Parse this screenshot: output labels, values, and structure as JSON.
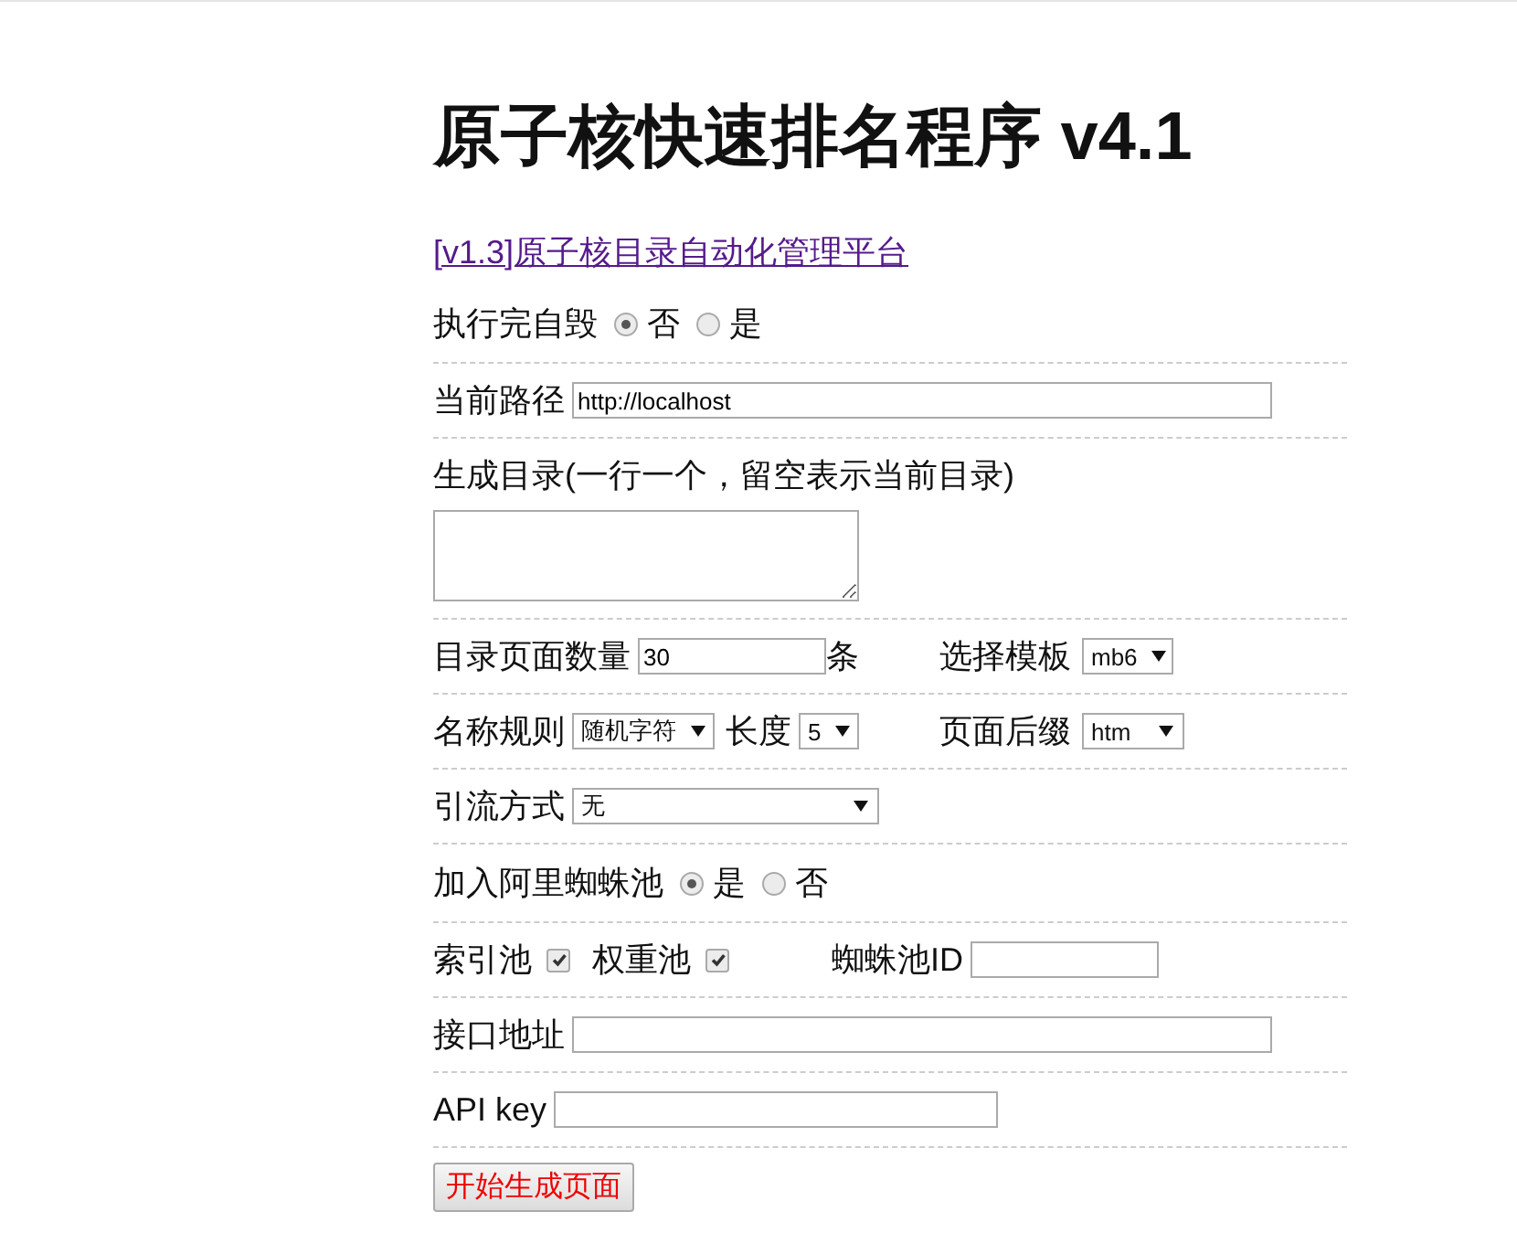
{
  "title": "原子核快速排名程序 v4.1",
  "link": "[v1.3]原子核目录自动化管理平台",
  "rows": [
    {
      "items": [
        {
          "kind": "text",
          "text": "执行完自毁"
        },
        {
          "kind": "radio",
          "label": "否",
          "selected": true
        },
        {
          "kind": "radio",
          "label": "是",
          "selected": false
        }
      ]
    },
    {
      "items": [
        {
          "kind": "text",
          "text": "当前路径"
        },
        {
          "kind": "input",
          "value": "http://localhost"
        }
      ]
    },
    {
      "items": [
        {
          "kind": "text",
          "text": "生成目录(一行一个，留空表示当前目录)"
        },
        {
          "kind": "textarea"
        }
      ]
    },
    {
      "items": [
        {
          "kind": "text",
          "text": "目录页面数量"
        },
        {
          "kind": "input",
          "value": "30"
        },
        {
          "kind": "text",
          "text": "条"
        },
        {
          "kind": "text",
          "text": "选择模板"
        },
        {
          "kind": "select",
          "value": "mb6"
        }
      ]
    },
    {
      "items": [
        {
          "kind": "text",
          "text": "名称规则"
        },
        {
          "kind": "select",
          "value": "随机字符"
        },
        {
          "kind": "text",
          "text": "长度"
        },
        {
          "kind": "select",
          "value": "5"
        },
        {
          "kind": "text",
          "text": "页面后缀"
        },
        {
          "kind": "select",
          "value": "htm"
        }
      ]
    },
    {
      "items": [
        {
          "kind": "text",
          "text": "引流方式"
        },
        {
          "kind": "select",
          "value": "无"
        }
      ]
    },
    {
      "items": [
        {
          "kind": "text",
          "text": "加入阿里蜘蛛池"
        },
        {
          "kind": "radio",
          "label": "是",
          "selected": true
        },
        {
          "kind": "radio",
          "label": "否",
          "selected": false
        }
      ]
    },
    {
      "items": [
        {
          "kind": "checkbox",
          "label": "索引池",
          "checked": true
        },
        {
          "kind": "checkbox",
          "label": "权重池",
          "checked": true
        },
        {
          "kind": "text",
          "text": "蜘蛛池ID"
        },
        {
          "kind": "input",
          "value": ""
        }
      ]
    },
    {
      "items": [
        {
          "kind": "text",
          "text": "接口地址"
        },
        {
          "kind": "input",
          "value": ""
        }
      ]
    },
    {
      "items": [
        {
          "kind": "text",
          "text": "API key"
        },
        {
          "kind": "input",
          "value": ""
        }
      ]
    }
  ],
  "button": "开始生成页面"
}
